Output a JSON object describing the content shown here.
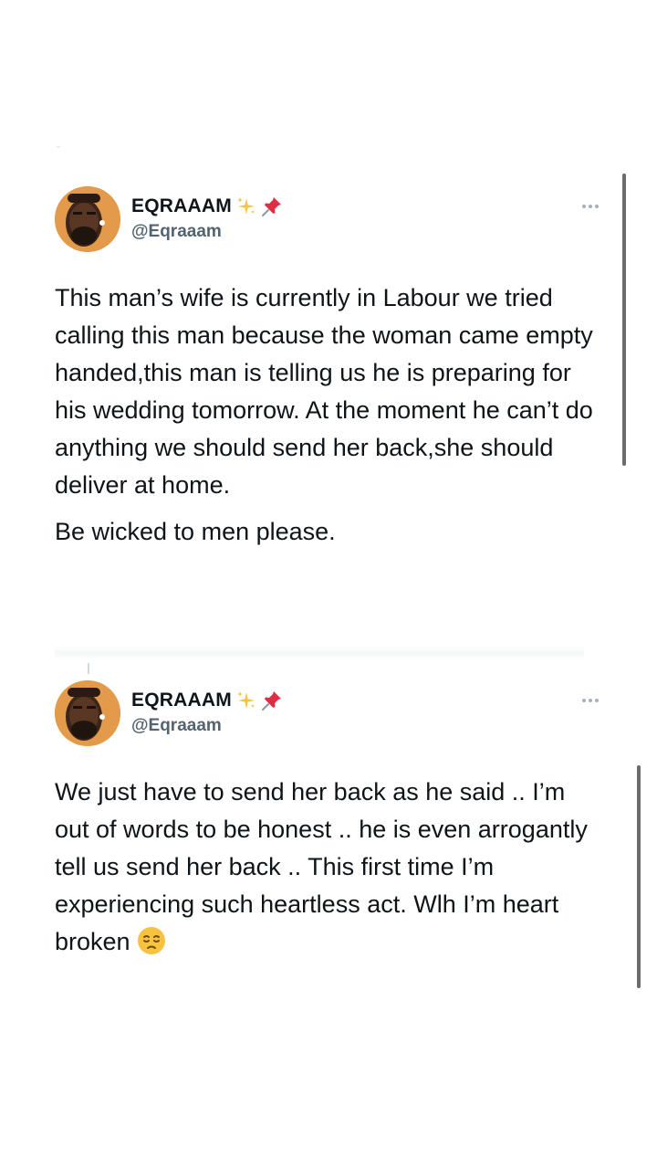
{
  "tweets": [
    {
      "author": {
        "display_name": "EQRAAAM",
        "handle": "@Eqraaam",
        "name_emojis": [
          "sparkles-icon",
          "pushpin-icon"
        ]
      },
      "paragraphs": [
        "This man’s wife is currently in Labour we tried calling this man because the woman came empty handed,this man is telling us he is preparing for his wedding tomorrow. At the moment he can’t do anything we should send her back,she should deliver at home.",
        "Be wicked to men please."
      ]
    },
    {
      "author": {
        "display_name": "EQRAAAM",
        "handle": "@Eqraaam",
        "name_emojis": [
          "sparkles-icon",
          "pushpin-icon"
        ]
      },
      "paragraphs": [
        "We just have to send her back as he said .. I’m out of words to be honest .. he is even arrogantly tell us send her back .. This first time I’m experiencing such heartless act. Wlh I’m heart broken"
      ],
      "trailing_emoji": "pensive-face-icon"
    }
  ],
  "colors": {
    "text": "#0f1419",
    "handle": "#536471",
    "more_dots": "#a6b1bb",
    "avatar_bg": "#e39a4b"
  }
}
